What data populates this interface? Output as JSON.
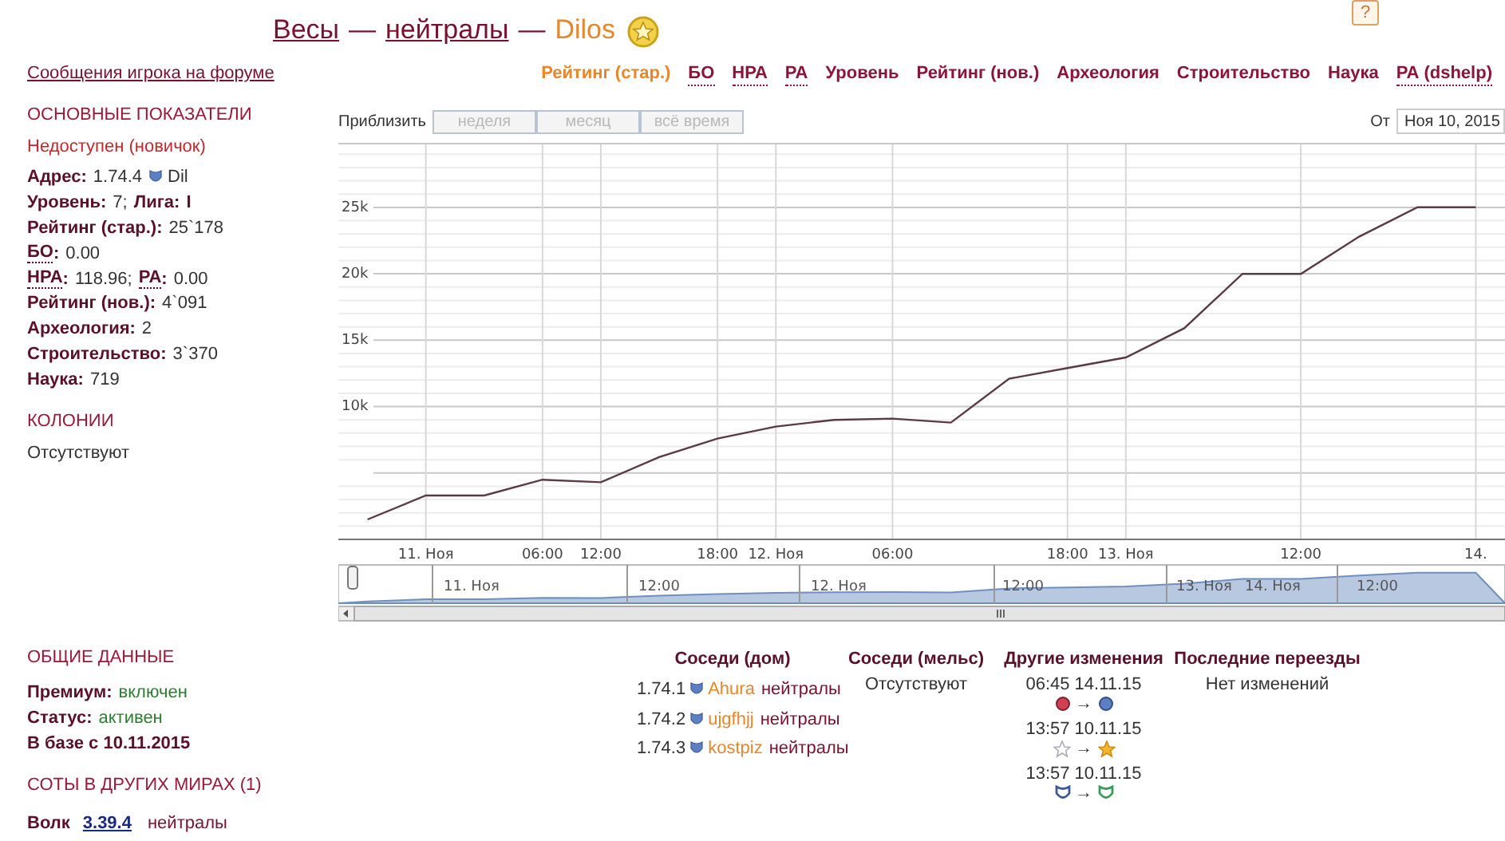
{
  "header": {
    "title_parts": [
      {
        "kind": "link",
        "text": "Весы"
      },
      {
        "kind": "sep",
        "text": "—"
      },
      {
        "kind": "link",
        "text": "нейтралы"
      },
      {
        "kind": "sep",
        "text": "—"
      },
      {
        "kind": "name",
        "text": "Dilos"
      }
    ],
    "help": "?"
  },
  "forum_link": "Сообщения игрока на форуме",
  "main_stats": {
    "title": "ОСНОВНЫЕ ПОКАЗАТЕЛИ",
    "status": "Недоступен (новичок)",
    "rows": [
      {
        "segments": [
          {
            "kind": "label",
            "text": "Адрес:"
          },
          {
            "kind": "value",
            "text": "1.74.4"
          },
          {
            "kind": "icon"
          },
          {
            "kind": "value",
            "text": "Dil"
          }
        ]
      },
      {
        "segments": [
          {
            "kind": "label",
            "text": "Уровень:"
          },
          {
            "kind": "value",
            "text": "7;"
          },
          {
            "kind": "label",
            "text": "Лига:"
          },
          {
            "kind": "label",
            "text": "I"
          }
        ]
      },
      {
        "segments": [
          {
            "kind": "label",
            "text": "Рейтинг (стар.):"
          },
          {
            "kind": "value",
            "text": "25`178"
          }
        ]
      },
      {
        "segments": [
          {
            "kind": "abbr",
            "text": "БО"
          },
          {
            "kind": "label",
            "text": ":"
          },
          {
            "kind": "value",
            "text": "0.00"
          }
        ]
      },
      {
        "segments": [
          {
            "kind": "abbr",
            "text": "НРА"
          },
          {
            "kind": "label",
            "text": ":"
          },
          {
            "kind": "value",
            "text": "118.96;"
          },
          {
            "kind": "abbr",
            "text": "РА"
          },
          {
            "kind": "label",
            "text": ":"
          },
          {
            "kind": "value",
            "text": "0.00"
          }
        ]
      },
      {
        "segments": [
          {
            "kind": "label",
            "text": "Рейтинг (нов.):"
          },
          {
            "kind": "value",
            "text": "4`091"
          }
        ]
      },
      {
        "segments": [
          {
            "kind": "label",
            "text": "Археология:"
          },
          {
            "kind": "value",
            "text": "2"
          }
        ]
      },
      {
        "segments": [
          {
            "kind": "label",
            "text": "Строительство:"
          },
          {
            "kind": "value",
            "text": "3`370"
          }
        ]
      },
      {
        "segments": [
          {
            "kind": "label",
            "text": "Наука:"
          },
          {
            "kind": "value",
            "text": "719"
          }
        ]
      }
    ]
  },
  "colonies": {
    "title": "КОЛОНИИ",
    "text": "Отсутствуют"
  },
  "tabs": [
    {
      "label": "Рейтинг (стар.)",
      "selected": true,
      "dotted": false
    },
    {
      "label": "БО",
      "selected": false,
      "dotted": true
    },
    {
      "label": "НРА",
      "selected": false,
      "dotted": true
    },
    {
      "label": "РА",
      "selected": false,
      "dotted": true
    },
    {
      "label": "Уровень",
      "selected": false,
      "dotted": false
    },
    {
      "label": "Рейтинг (нов.)",
      "selected": false,
      "dotted": false
    },
    {
      "label": "Археология",
      "selected": false,
      "dotted": false
    },
    {
      "label": "Строительство",
      "selected": false,
      "dotted": false
    },
    {
      "label": "Наука",
      "selected": false,
      "dotted": false
    },
    {
      "label": "РА (dshelp)",
      "selected": false,
      "dotted": true
    }
  ],
  "chart_toolbar": {
    "zoom_label": "Приблизить",
    "zoom_buttons": [
      {
        "label": "неделя",
        "disabled": true
      },
      {
        "label": "месяц",
        "disabled": true
      },
      {
        "label": "всё время",
        "disabled": true
      }
    ],
    "from_label": "От",
    "from_value": "Ноя 10, 2015"
  },
  "chart": {
    "chart_data": {
      "type": "line",
      "categories": [
        null,
        "11. Ноя",
        null,
        "06:00",
        "12:00",
        null,
        "18:00",
        "12. Ноя",
        null,
        "06:00",
        null,
        null,
        "18:00",
        "13. Ноя",
        null,
        null,
        "12:00",
        null,
        null,
        "14."
      ],
      "series": [
        {
          "color": "#5a3a44",
          "values": [
            1500,
            3300,
            3300,
            4500,
            4300,
            6200,
            7600,
            8500,
            9000,
            9100,
            8800,
            12100,
            12900,
            13700,
            15900,
            20000,
            20000,
            22800,
            25000,
            25000
          ]
        }
      ],
      "ylim": [
        0,
        29800
      ],
      "grid": true,
      "yticks": [
        {
          "value": 10000,
          "label": "10k"
        },
        {
          "value": 15000,
          "label": "15k"
        },
        {
          "value": 20000,
          "label": "20k"
        },
        {
          "value": 25000,
          "label": "25k"
        }
      ]
    },
    "navigator_labels": [
      "11. Ноя",
      "12:00",
      "12. Ноя",
      "12:00",
      "13. Ноя",
      "14. Ноя",
      "12:00"
    ]
  },
  "general": {
    "title": "ОБЩИЕ ДАННЫЕ",
    "rows": [
      {
        "label": "Премиум:",
        "value": "включен"
      },
      {
        "label": "Статус:",
        "value": "активен"
      },
      {
        "label": "В базе с 10.11.2015"
      }
    ]
  },
  "other_worlds": {
    "title": "СОТЫ В ДРУГИХ МИРАХ (1)",
    "rows": [
      {
        "name": "Волк",
        "address": "3.39.4",
        "faction": "нейтралы"
      }
    ]
  },
  "neighbors": {
    "columns": [
      "Соседи (дом)",
      "Соседи (мельс)",
      "Другие изменения",
      "Последние переезды"
    ],
    "home": [
      {
        "address": "1.74.1",
        "name": "Ahura",
        "faction": "нейтралы"
      },
      {
        "address": "1.74.2",
        "name": "ujgfhjj",
        "faction": "нейтралы"
      },
      {
        "address": "1.74.3",
        "name": "kostpiz",
        "faction": "нейтралы"
      }
    ],
    "mels": "Отсутствуют",
    "changes": [
      {
        "time": "06:45 14.11.15",
        "icons": [
          {
            "kind": "red-orb"
          },
          {
            "kind": "blue-orb"
          }
        ],
        "arrow": "→"
      },
      {
        "time": "13:57 10.11.15",
        "icons": [
          {
            "kind": "star-empty"
          },
          {
            "kind": "star-filled"
          }
        ],
        "arrow": "→"
      },
      {
        "time": "13:57 10.11.15",
        "icons": [
          {
            "kind": "race-blue"
          },
          {
            "kind": "race-green"
          }
        ],
        "arrow": "→"
      }
    ],
    "moves": "Нет изменений"
  }
}
